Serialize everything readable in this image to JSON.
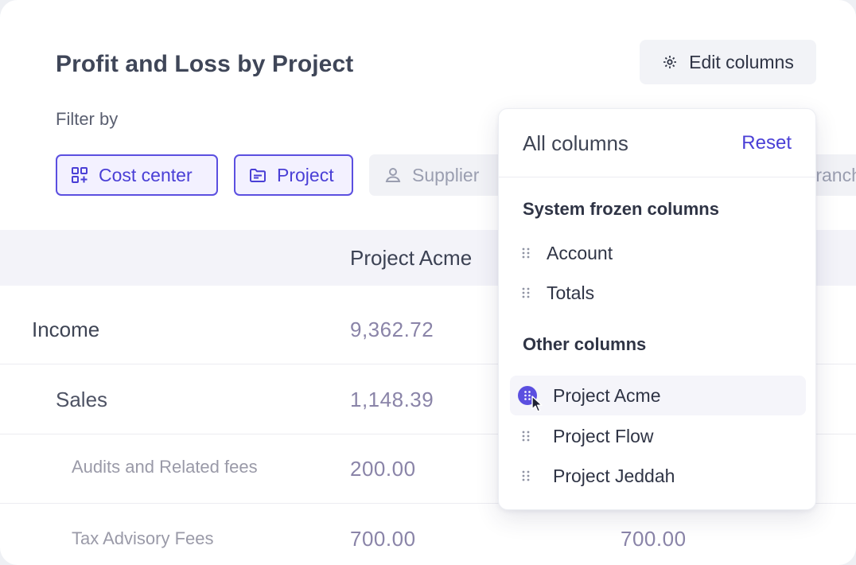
{
  "page": {
    "title": "Profit and Loss by Project",
    "edit_columns_label": "Edit columns",
    "filter_label": "Filter by"
  },
  "filters": {
    "cost_center": "Cost center",
    "project": "Project",
    "supplier": "Supplier",
    "branch": "Branch"
  },
  "table": {
    "column_header": "Project Acme",
    "rows": {
      "income": {
        "label": "Income",
        "value": "9,362.72"
      },
      "sales": {
        "label": "Sales",
        "value": "1,148.39"
      },
      "audits": {
        "label": "Audits and Related fees",
        "value": "200.00"
      },
      "tax": {
        "label": "Tax Advisory Fees",
        "value": "700.00",
        "value2": "700.00"
      }
    }
  },
  "columns_panel": {
    "title": "All columns",
    "reset_label": "Reset",
    "frozen_title": "System frozen columns",
    "frozen": [
      "Account",
      "Totals"
    ],
    "other_title": "Other columns",
    "other": [
      "Project Acme",
      "Project Flow",
      "Project Jeddah"
    ]
  },
  "colors": {
    "accent": "#5b4fe0",
    "chip_active_bg": "#f3f1ff",
    "header_bg": "#f3f3f9"
  },
  "icons": {
    "edit_columns": "gear-icon",
    "cost_center": "grid-plus-icon",
    "project": "folder-icon",
    "supplier": "user-icon",
    "drag": "drag-handle-icon",
    "cursor": "mouse-cursor-icon"
  }
}
